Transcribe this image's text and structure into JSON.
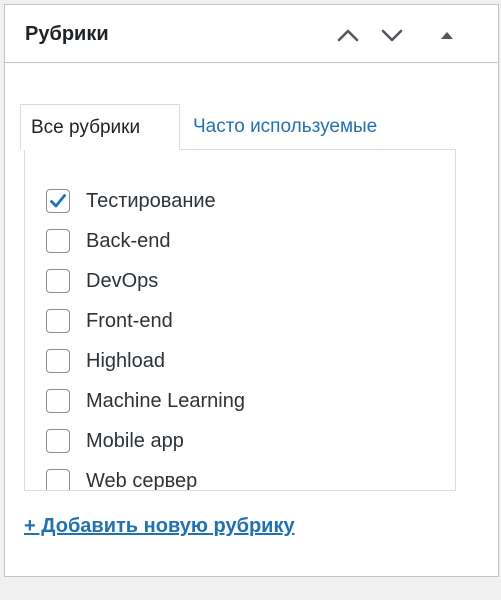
{
  "panel": {
    "title": "Рубрики",
    "move_up_icon": "chevron-up-icon",
    "move_down_icon": "chevron-down-icon",
    "toggle_icon": "triangle-up-icon"
  },
  "tabs": [
    {
      "label": "Все рубрики",
      "active": true
    },
    {
      "label": "Часто используемые",
      "active": false
    }
  ],
  "categories": [
    {
      "label": "Тестирование",
      "checked": true
    },
    {
      "label": "Back-end",
      "checked": false
    },
    {
      "label": "DevOps",
      "checked": false
    },
    {
      "label": "Front-end",
      "checked": false
    },
    {
      "label": "Highload",
      "checked": false
    },
    {
      "label": "Machine Learning",
      "checked": false
    },
    {
      "label": "Mobile app",
      "checked": false
    },
    {
      "label": "Web сервер",
      "checked": false
    }
  ],
  "add_link": "+ Добавить новую рубрику",
  "colors": {
    "accent": "#2271b1",
    "border": "#c3c4c7",
    "text": "#1d2327"
  }
}
